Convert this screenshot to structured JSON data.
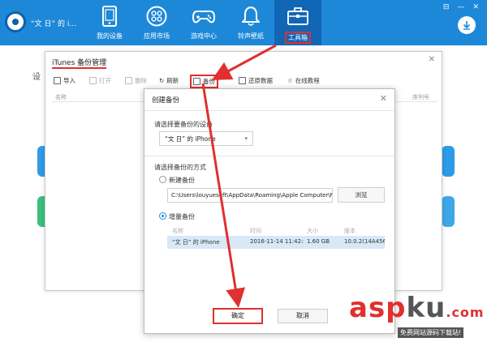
{
  "app": {
    "device_name": "“文   日” 的 i...",
    "nav": [
      {
        "label": "我的设备",
        "icon": "phone-icon"
      },
      {
        "label": "应用市场",
        "icon": "apps-grid-icon"
      },
      {
        "label": "游戏中心",
        "icon": "gamepad-icon"
      },
      {
        "label": "铃声壁纸",
        "icon": "bell-icon"
      },
      {
        "label": "工具箱",
        "icon": "toolbox-icon",
        "active": true
      }
    ],
    "window_buttons": [
      "⊟",
      "—",
      "✕"
    ],
    "background_label": "设"
  },
  "itunes_dialog": {
    "title": "iTunes 备份管理",
    "close": "✕",
    "toolbar": {
      "import": "导入",
      "open": "打开",
      "delete": "删除",
      "refresh": "刷新",
      "backup": "备份",
      "restore": "还原数据",
      "tutorial": "在线教程"
    },
    "col_name": "名称",
    "col_serial": "序列号"
  },
  "create_dialog": {
    "title": "创建备份",
    "close": "✕",
    "select_device_label": "请选择要备份的设备",
    "device_value": "“文   日” 的 iPhone",
    "method_label": "请选择备份的方式",
    "new_backup_label": "新建备份",
    "path_value": "C:\\Users\\louyuesoft\\AppData\\Roaming\\Apple Computer\\M",
    "browse_label": "浏览",
    "incremental_label": "增量备份",
    "table_headers": {
      "name": "名称",
      "time": "时间",
      "size": "大小",
      "version": "版本"
    },
    "table_row": {
      "name": "“文   日” 的 iPhone",
      "time": "2016-11-14 11:42:42",
      "size": "1.60 GB",
      "version": "10.0.2(14A456)"
    },
    "ok_label": "确定",
    "cancel_label": "取消"
  },
  "watermark": {
    "main_asp": "asp",
    "main_ku": "ku",
    "main_com": ".com",
    "sub": "免费网站源码下载站!"
  },
  "colors": {
    "topbar": "#1e88d8",
    "accent_red": "#e03030",
    "selected_row": "#d8e8f7"
  }
}
